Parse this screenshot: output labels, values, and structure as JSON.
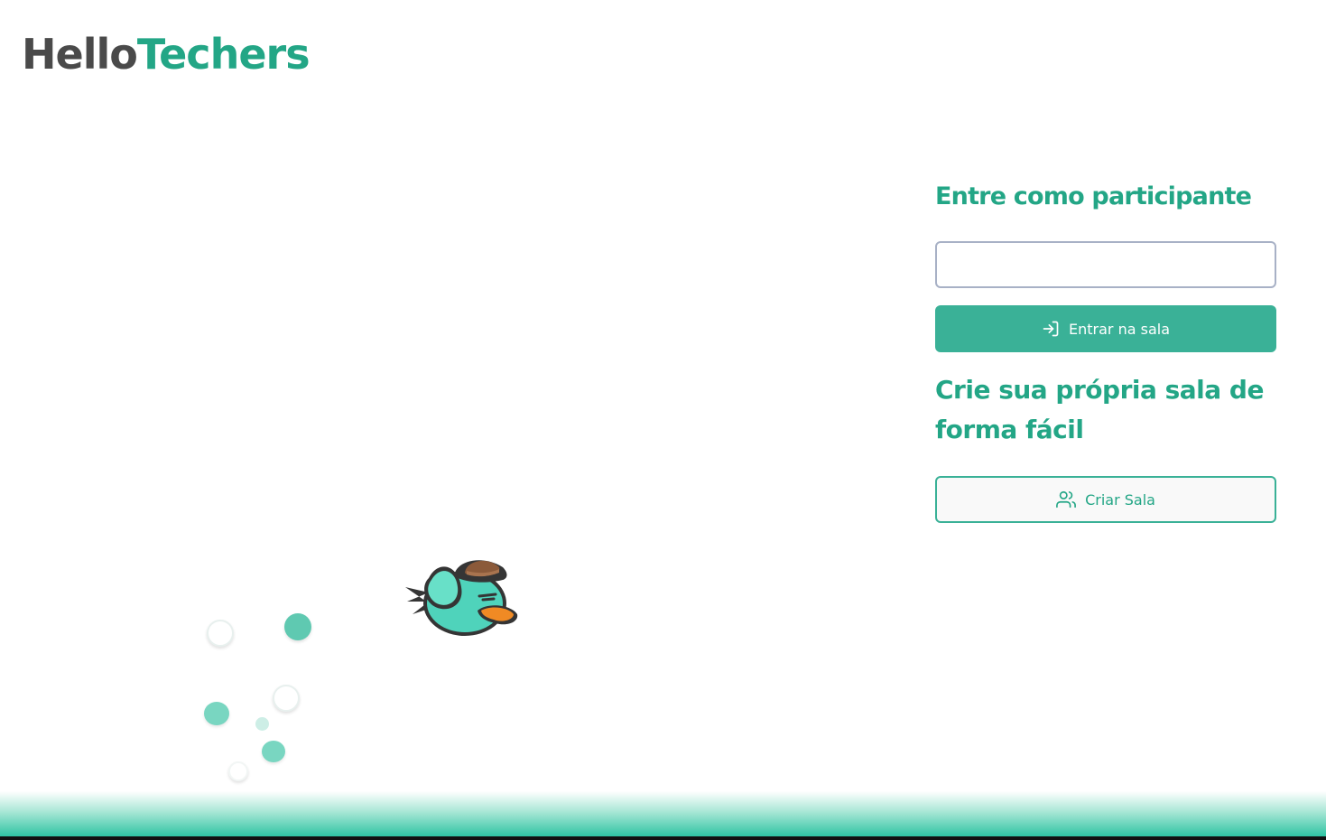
{
  "logo": {
    "part1": "Hello",
    "part2": "Techers"
  },
  "join": {
    "heading": "Entre como participante",
    "input_value": "",
    "button_label": "Entrar na sala",
    "button_icon": "log-in-icon"
  },
  "create": {
    "heading": "Crie sua própria sala de forma fácil",
    "button_label": "Criar Sala",
    "button_icon": "users-icon"
  },
  "colors": {
    "brand": "#23a686",
    "button": "#3ab197",
    "logo_dark": "#4a4a4a"
  }
}
